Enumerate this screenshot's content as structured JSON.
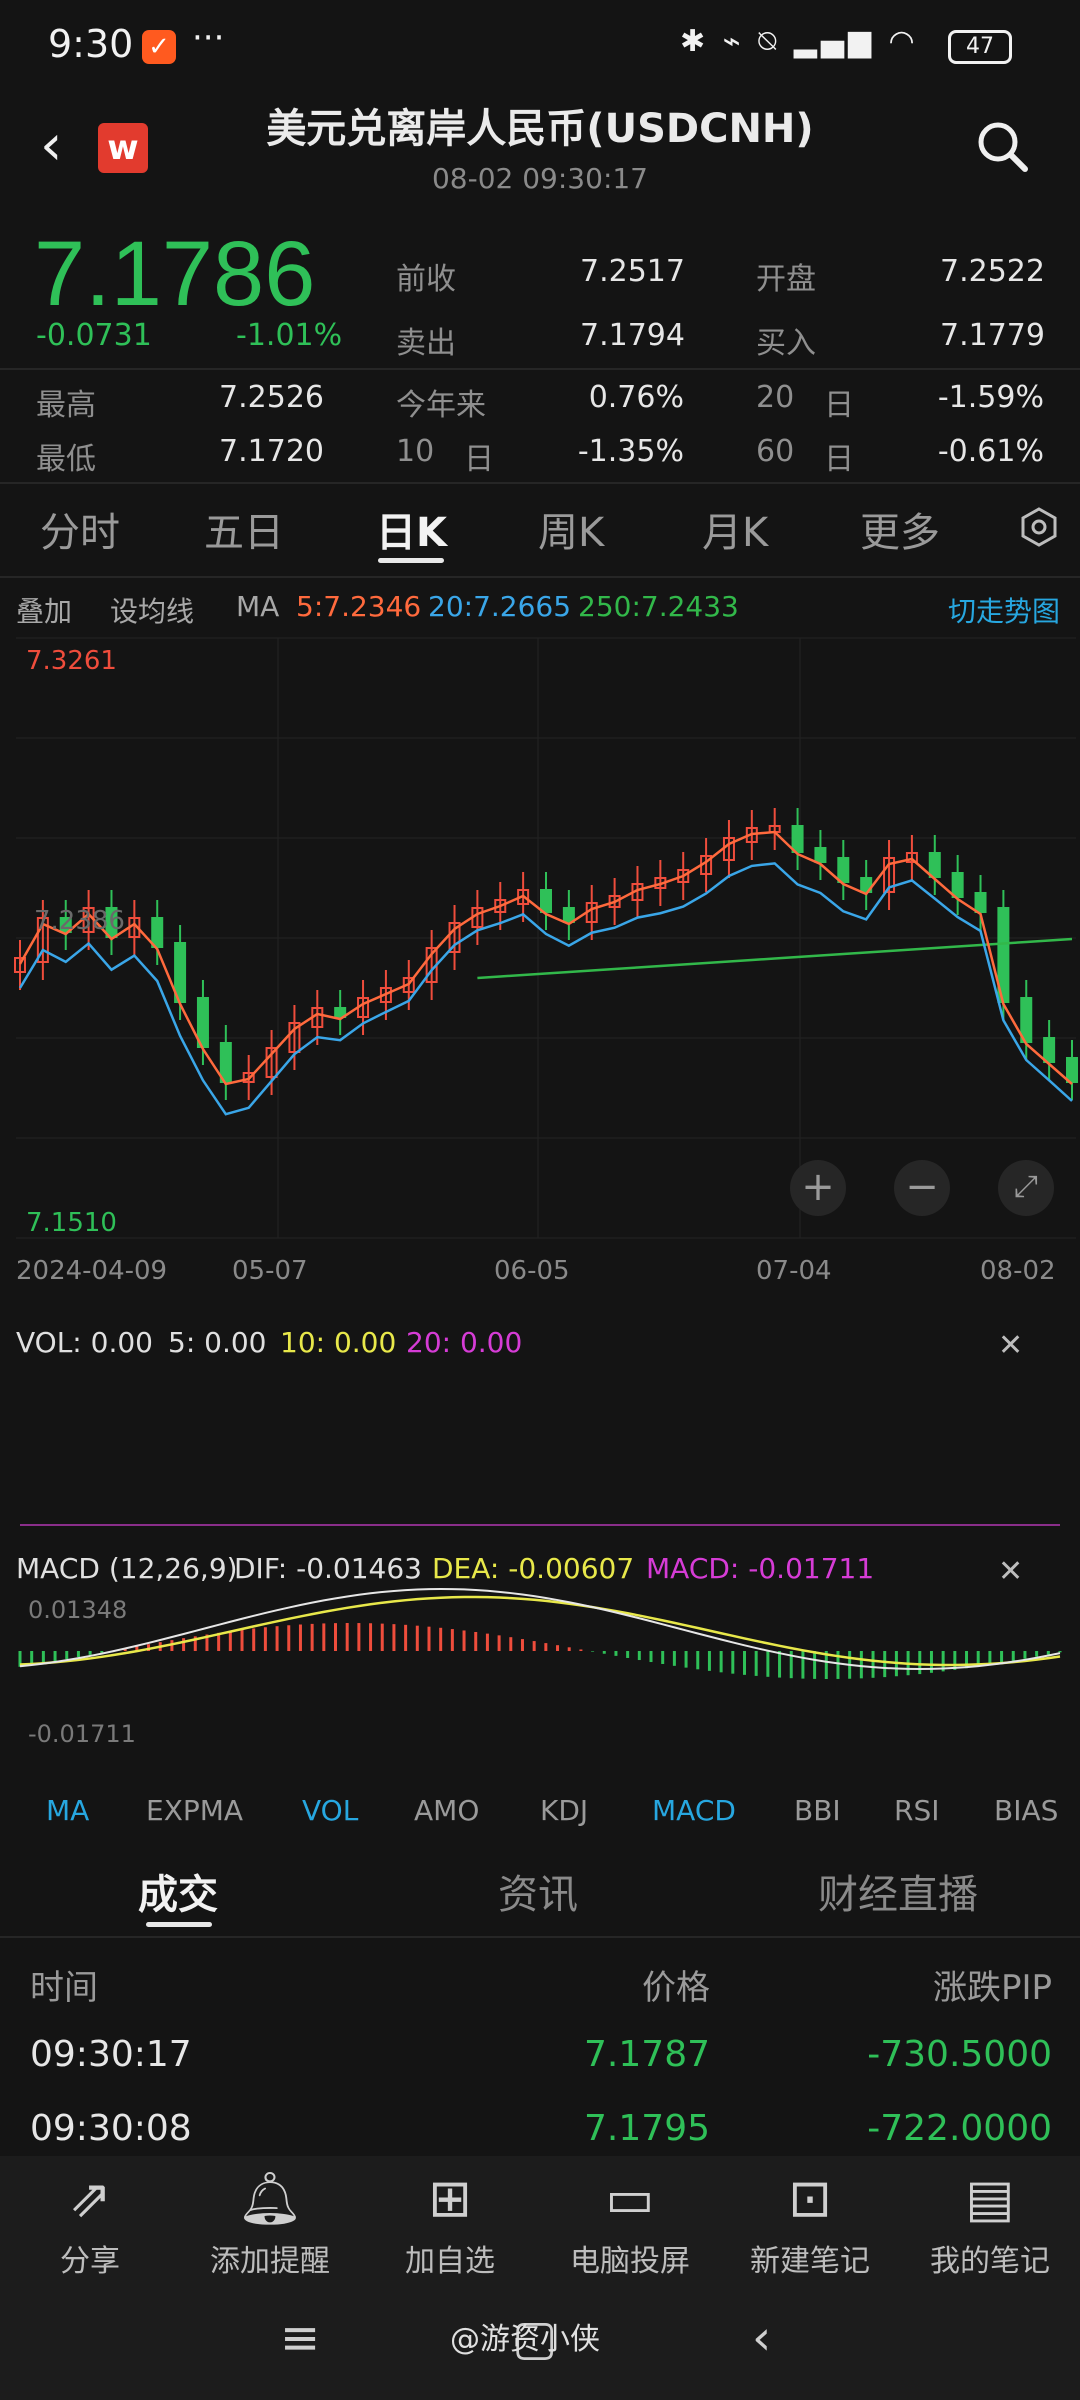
{
  "status_bar": {
    "time": "9:30",
    "battery": "47"
  },
  "header": {
    "title": "美元兑离岸人民币(USDCNH)",
    "subtitle": "08-02 09:30:17"
  },
  "quote": {
    "price": "7.1786",
    "change": "-0.0731",
    "change_pct": "-1.01%",
    "fields": [
      {
        "label": "前收",
        "value": "7.2517"
      },
      {
        "label": "开盘",
        "value": "7.2522"
      },
      {
        "label": "卖出",
        "value": "7.1794"
      },
      {
        "label": "买入",
        "value": "7.1779"
      }
    ],
    "stats": [
      {
        "label": "最高",
        "value": "7.2526"
      },
      {
        "label": "今年来",
        "value": "0.76%"
      },
      {
        "label": "20",
        "unit": "日",
        "value": "-1.59%"
      },
      {
        "label": "最低",
        "value": "7.1720"
      },
      {
        "label": "10",
        "unit": "日",
        "value": "-1.35%"
      },
      {
        "label": "60",
        "unit": "日",
        "value": "-0.61%"
      }
    ]
  },
  "period_tabs": [
    "分时",
    "五日",
    "日K",
    "周K",
    "月K",
    "更多"
  ],
  "chart_toolbar": {
    "overlay": "叠加",
    "ma_setting": "设均线",
    "ma_label": "MA",
    "ma5": "5:7.2346",
    "ma20": "20:7.2665",
    "ma250": "250:7.2433",
    "switch": "切走势图"
  },
  "colors": {
    "ma5": "#ff6a3d",
    "ma20": "#3aa6e8",
    "ma250": "#32b84a",
    "up": "#ef4d3c",
    "down": "#2fc058",
    "accent": "#27a7e0"
  },
  "chart_data": {
    "type": "candlestick",
    "y_top_label": "7.3261",
    "y_bottom_label": "7.1510",
    "crosshair_label": "7.2386",
    "x_labels": [
      "2024-04-09",
      "05-07",
      "06-05",
      "07-04",
      "08-02"
    ],
    "ylim": [
      7.151,
      7.3261
    ]
  },
  "volume": {
    "label": "VOL: 0.00",
    "ma5": "5: 0.00",
    "ma10": "10: 0.00",
    "ma20": "20: 0.00"
  },
  "macd": {
    "label": "MACD (12,26,9)",
    "dif": "DIF: -0.01463",
    "dea": "DEA: -0.00607",
    "macd": "MACD: -0.01711",
    "y_top": "0.01348",
    "y_bottom": "-0.01711"
  },
  "indicator_tabs": [
    "MA",
    "EXPMA",
    "VOL",
    "AMO",
    "KDJ",
    "MACD",
    "BBI",
    "RSI",
    "BIAS"
  ],
  "content_tabs": [
    "成交",
    "资讯",
    "财经直播"
  ],
  "trades": {
    "headers": [
      "时间",
      "价格",
      "涨跌PIP"
    ],
    "rows": [
      {
        "time": "09:30:17",
        "price": "7.1787",
        "pip": "-730.5000"
      },
      {
        "time": "09:30:08",
        "price": "7.1795",
        "pip": "-722.0000"
      }
    ]
  },
  "bottom_bar": [
    {
      "label": "分享",
      "icon": "share-icon"
    },
    {
      "label": "添加提醒",
      "icon": "bell-icon"
    },
    {
      "label": "加自选",
      "icon": "add-watchlist-icon"
    },
    {
      "label": "电脑投屏",
      "icon": "cast-screen-icon"
    },
    {
      "label": "新建笔记",
      "icon": "new-note-icon"
    },
    {
      "label": "我的笔记",
      "icon": "notebook-icon"
    }
  ],
  "watermark": "@游资小侠"
}
